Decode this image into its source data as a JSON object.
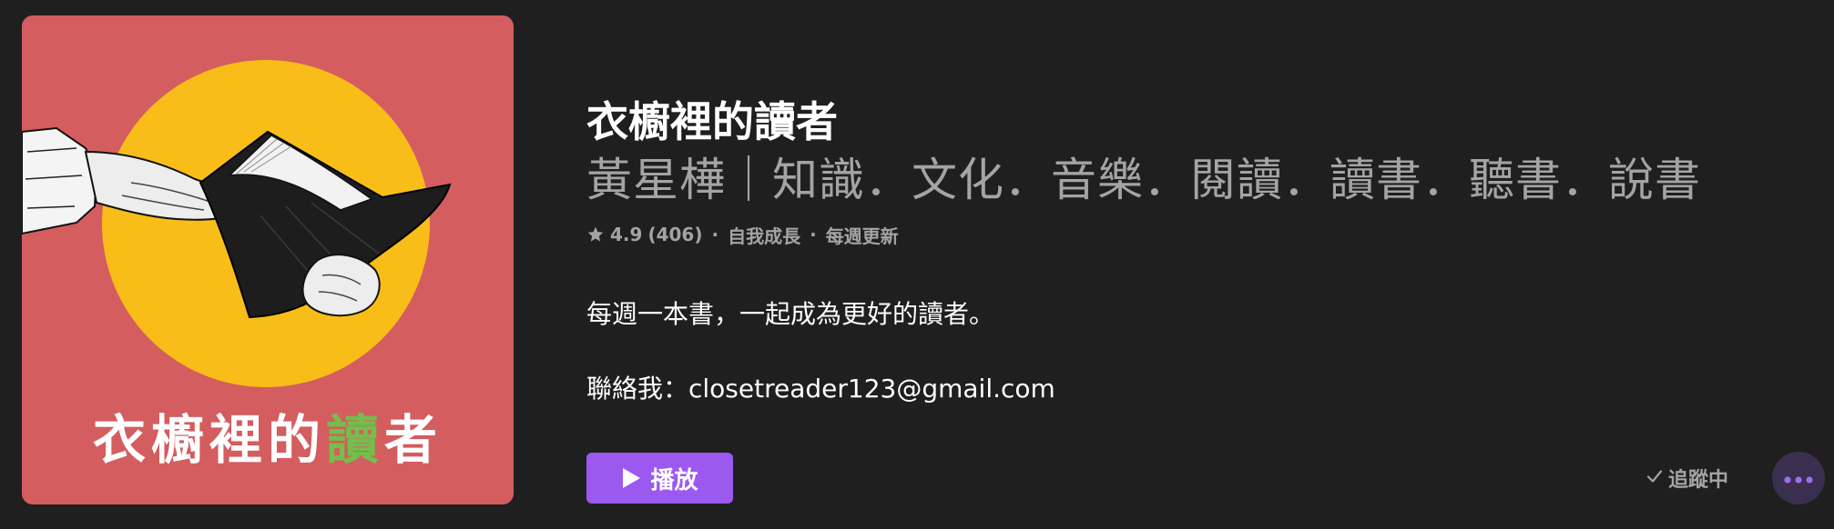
{
  "artwork": {
    "title_part1": "衣櫥裡的",
    "title_highlight": "讀",
    "title_part2": "者",
    "background_color": "#d45d5f",
    "circle_color": "#f8bd18",
    "highlight_color": "#74be4c"
  },
  "podcast": {
    "title": "衣櫥裡的讀者",
    "subtitle": "黃星樺｜知識．文化．音樂．閱讀．讀書．聽書．說書",
    "rating": "4.9",
    "rating_count": "(406)",
    "category": "自我成長",
    "frequency": "每週更新",
    "separator": "·",
    "description": "每週一本書，一起成為更好的讀者。",
    "contact": "聯絡我：closetreader123@gmail.com"
  },
  "actions": {
    "play_label": "播放",
    "following_label": "追蹤中",
    "accent_color": "#9b59f0"
  },
  "icons": {
    "star": "star-icon",
    "play": "play-icon",
    "check": "check-icon",
    "more": "more-icon"
  }
}
